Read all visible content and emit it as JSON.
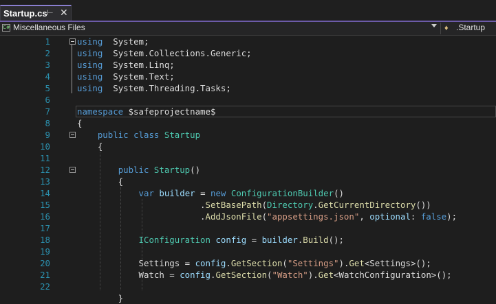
{
  "tab": {
    "title": "Startup.cs",
    "pin_icon": "pin-icon",
    "close_icon": "close-icon"
  },
  "navbar": {
    "project": "Miscellaneous Files",
    "project_icon": "csharp-project-icon",
    "member": ".Startup",
    "member_icon": "class-icon"
  },
  "editor": {
    "line_numbers": [
      "1",
      "2",
      "3",
      "4",
      "5",
      "6",
      "7",
      "8",
      "9",
      "10",
      "11",
      "12",
      "13",
      "14",
      "15",
      "16",
      "17",
      "18",
      "19",
      "20",
      "21",
      "22"
    ],
    "lines": [
      [
        [
          "kw",
          "using"
        ],
        [
          "",
          "  System;"
        ]
      ],
      [
        [
          "kw",
          "using"
        ],
        [
          "",
          "  System.Collections.Generic;"
        ]
      ],
      [
        [
          "kw",
          "using"
        ],
        [
          "",
          "  System.Linq;"
        ]
      ],
      [
        [
          "kw",
          "using"
        ],
        [
          "",
          "  System.Text;"
        ]
      ],
      [
        [
          "kw",
          "using"
        ],
        [
          "",
          "  System.Threading.Tasks;"
        ]
      ],
      [],
      [
        [
          "kw",
          "namespace"
        ],
        [
          "",
          " $safeprojectname$"
        ]
      ],
      [
        [
          "",
          "{"
        ]
      ],
      [
        [
          "",
          "    "
        ],
        [
          "kw",
          "public"
        ],
        [
          "",
          " "
        ],
        [
          "kw",
          "class"
        ],
        [
          "",
          " "
        ],
        [
          "ty",
          "Startup"
        ]
      ],
      [
        [
          "",
          "    {"
        ]
      ],
      [],
      [
        [
          "",
          "        "
        ],
        [
          "kw",
          "public"
        ],
        [
          "",
          " "
        ],
        [
          "ty",
          "Startup"
        ],
        [
          "",
          "()"
        ]
      ],
      [
        [
          "",
          "        {"
        ]
      ],
      [
        [
          "",
          "            "
        ],
        [
          "kw",
          "var"
        ],
        [
          "",
          " "
        ],
        [
          "var",
          "builder"
        ],
        [
          "",
          " = "
        ],
        [
          "kw",
          "new"
        ],
        [
          "",
          " "
        ],
        [
          "ty",
          "ConfigurationBuilder"
        ],
        [
          "",
          "()"
        ]
      ],
      [
        [
          "",
          "                        ."
        ],
        [
          "mt",
          "SetBasePath"
        ],
        [
          "",
          "("
        ],
        [
          "ty",
          "Directory"
        ],
        [
          "",
          "."
        ],
        [
          "mt",
          "GetCurrentDirectory"
        ],
        [
          "",
          "())"
        ]
      ],
      [
        [
          "",
          "                        ."
        ],
        [
          "mt",
          "AddJsonFile"
        ],
        [
          "",
          "("
        ],
        [
          "str",
          "\"appsettings.json\""
        ],
        [
          "",
          ", "
        ],
        [
          "var",
          "optional"
        ],
        [
          "",
          ": "
        ],
        [
          "kw",
          "false"
        ],
        [
          "",
          ");"
        ]
      ],
      [],
      [
        [
          "",
          "            "
        ],
        [
          "ty",
          "IConfiguration"
        ],
        [
          "",
          " "
        ],
        [
          "var",
          "config"
        ],
        [
          "",
          " = "
        ],
        [
          "var",
          "builder"
        ],
        [
          "",
          "."
        ],
        [
          "mt",
          "Build"
        ],
        [
          "",
          "();"
        ]
      ],
      [],
      [
        [
          "",
          "            Settings = "
        ],
        [
          "var",
          "config"
        ],
        [
          "",
          "."
        ],
        [
          "mt",
          "GetSection"
        ],
        [
          "",
          "("
        ],
        [
          "str",
          "\"Settings\""
        ],
        [
          "",
          ")."
        ],
        [
          "mt",
          "Get"
        ],
        [
          "",
          "<Settings>();"
        ]
      ],
      [
        [
          "",
          "            Watch = "
        ],
        [
          "var",
          "config"
        ],
        [
          "",
          "."
        ],
        [
          "mt",
          "GetSection"
        ],
        [
          "",
          "("
        ],
        [
          "str",
          "\"Watch\""
        ],
        [
          "",
          ")."
        ],
        [
          "mt",
          "Get"
        ],
        [
          "",
          "<WatchConfiguration>();"
        ]
      ],
      [],
      [
        [
          "",
          "        }"
        ]
      ]
    ]
  }
}
